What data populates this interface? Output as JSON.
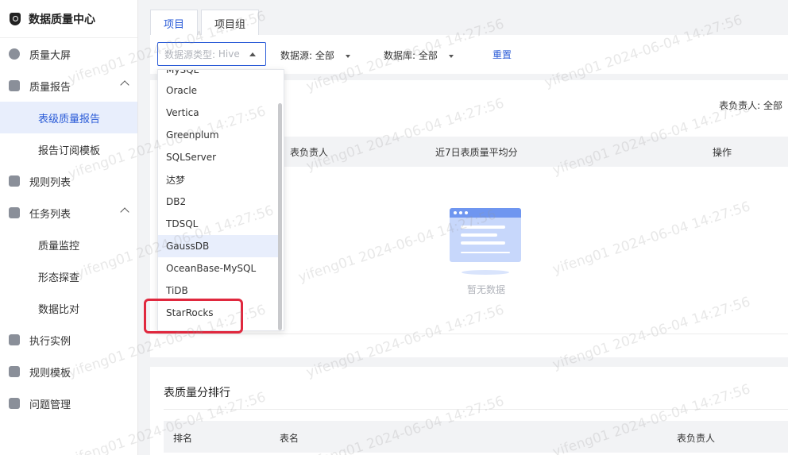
{
  "app": {
    "title": "数据质量中心"
  },
  "sidebar": {
    "items": [
      {
        "label": "质量大屏"
      },
      {
        "label": "质量报告"
      },
      {
        "label": "表级质量报告"
      },
      {
        "label": "报告订阅模板"
      },
      {
        "label": "规则列表"
      },
      {
        "label": "任务列表"
      },
      {
        "label": "质量监控"
      },
      {
        "label": "形态探查"
      },
      {
        "label": "数据比对"
      },
      {
        "label": "执行实例"
      },
      {
        "label": "规则模板"
      },
      {
        "label": "问题管理"
      }
    ]
  },
  "tabs": [
    {
      "label": "项目"
    },
    {
      "label": "项目组"
    }
  ],
  "filters": {
    "datasource_type": {
      "label": "数据源类型:",
      "value": "Hive"
    },
    "datasource": "数据源: 全部",
    "database": "数据库: 全部",
    "reset": "重置"
  },
  "dropdown": {
    "partial_top": "MySQL",
    "options": [
      "Oracle",
      "Vertica",
      "Greenplum",
      "SQLServer",
      "达梦",
      "DB2",
      "TDSQL",
      "GaussDB",
      "OceanBase-MySQL",
      "TiDB",
      "StarRocks"
    ],
    "hovered": "GaussDB",
    "highlighted": "StarRocks"
  },
  "table": {
    "owner_filter": "表负责人: 全部",
    "columns": [
      "表负责人",
      "近7日表质量平均分",
      "操作"
    ],
    "empty_text": "暂无数据"
  },
  "ranking": {
    "title": "表质量分排行",
    "columns": [
      "排名",
      "表名",
      "表负责人"
    ]
  },
  "watermark": "yifeng01 2024-06-04 14:27:56",
  "colors": {
    "accent": "#2a5bd7",
    "highlight_border": "#e0283e",
    "active_bg": "#e8eefc"
  }
}
